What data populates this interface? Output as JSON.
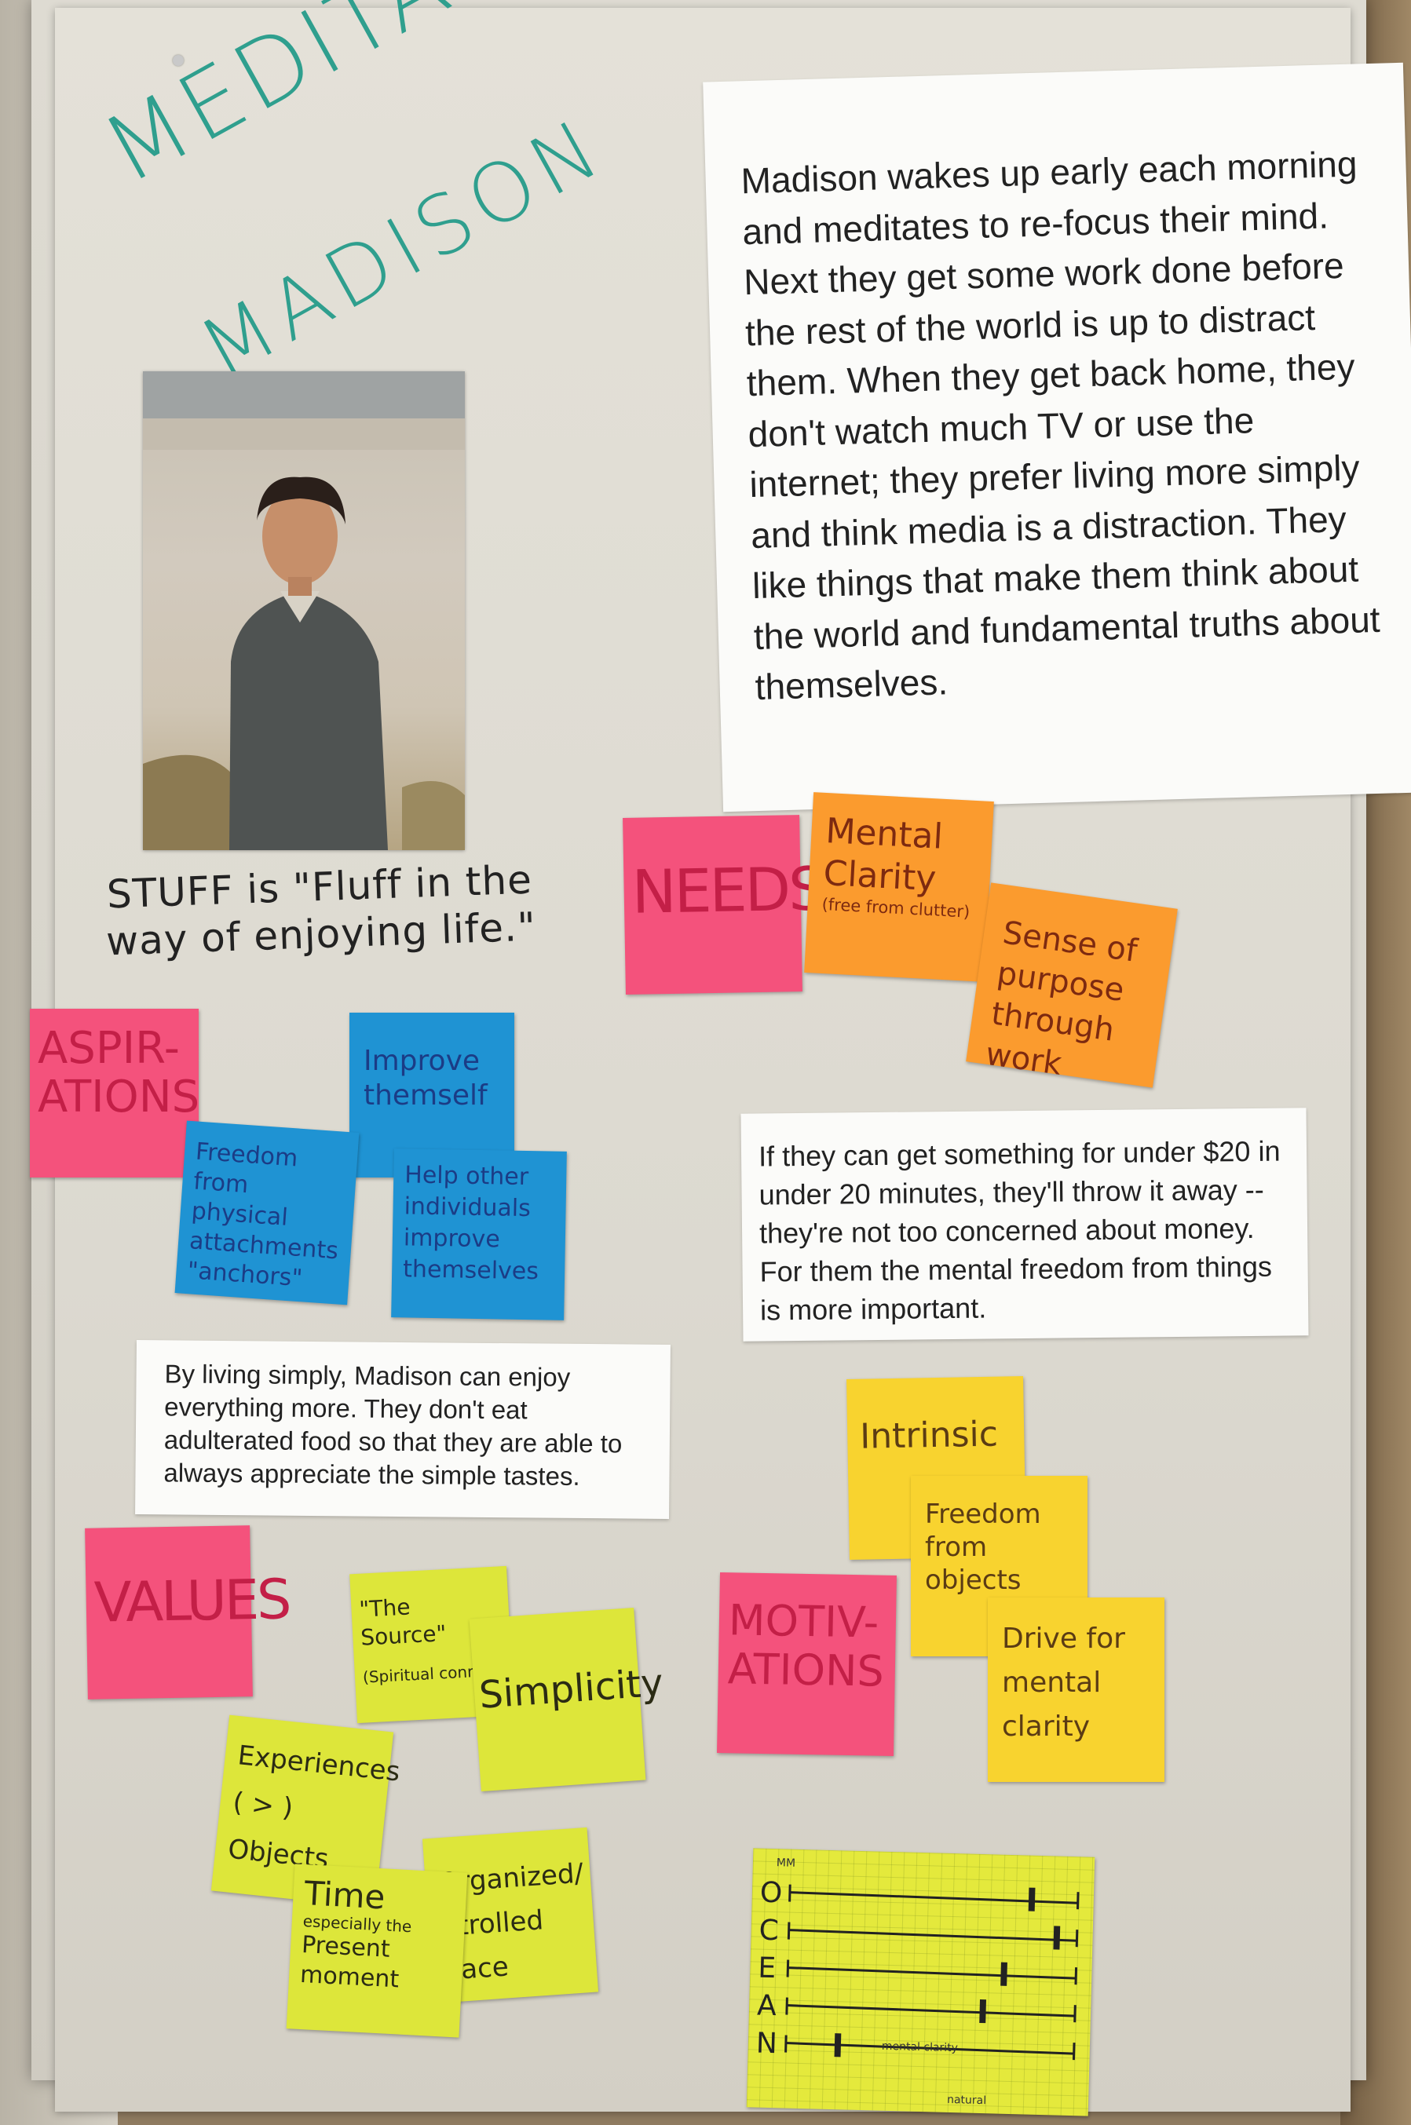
{
  "title": {
    "line1": "MEDITATIVE",
    "line2": "MADISON"
  },
  "description": "Madison wakes up early each morning and meditates to re-focus their mind. Next they get some work done before the rest of the world is up to distract them. When they get back home, they don't watch much TV or use the internet; they prefer living more simply and think media is a distraction. They like things that make them think about the world and fundamental truths about themselves.",
  "quote": "STUFF is \"Fluff in the way of enjoying life.\"",
  "needs": {
    "label": "NEEDS",
    "items": [
      {
        "text": "Mental Clarity",
        "sub": "(free from clutter)"
      },
      {
        "text": "Sense of purpose through work"
      }
    ]
  },
  "aspirations": {
    "label": "ASPIR-ATIONS",
    "items": [
      {
        "text": "Improve themself"
      },
      {
        "text": "Freedom from physical attachments \"anchors\""
      },
      {
        "text": "Help other individuals improve themselves"
      }
    ]
  },
  "money_note": "If they can get something for under $20 in under 20 minutes, they'll throw it away -- they're not too concerned about money. For them the mental freedom from things is more important.",
  "simple_note": "By living simply, Madison can enjoy everything more. They don't eat adulterated food so that they are able to always appreciate the simple tastes.",
  "values": {
    "label": "VALUES",
    "items": [
      {
        "text": "\"The Source\"",
        "sub": "(Spiritual conne"
      },
      {
        "text": "Simplicity"
      },
      {
        "text": "Experiences ( > ) Objects"
      },
      {
        "text": "Time",
        "sub": "especially the",
        "tail": "Present moment"
      },
      {
        "text": "Organized/ ntrolled pace"
      }
    ]
  },
  "motivations": {
    "label": "MOTIV-ATIONS",
    "items": [
      {
        "text": "Intrinsic"
      },
      {
        "text": "Freedom from objects"
      },
      {
        "text": "Drive for mental clarity"
      }
    ]
  },
  "ocean": {
    "header": "MM",
    "traits": [
      {
        "letter": "O",
        "level": 0.84
      },
      {
        "letter": "C",
        "level": 0.93
      },
      {
        "letter": "E",
        "level": 0.75
      },
      {
        "letter": "A",
        "level": 0.68
      },
      {
        "letter": "N",
        "level": 0.18
      }
    ],
    "annotation_top": "mental clarity",
    "annotation_bottom": "natural"
  },
  "colors": {
    "title": "#2f9f8e",
    "pink": "#f4527c",
    "orange": "#fb9b2e",
    "blue": "#1f93d3",
    "yellow": "#f8d32f",
    "lime": "#dde63a"
  }
}
